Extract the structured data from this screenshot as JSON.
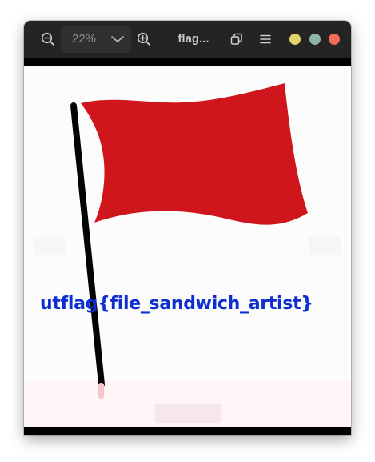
{
  "window": {
    "title": "flag...",
    "zoom_value": "22%"
  },
  "toolbar": {
    "zoom_out_icon": "zoom-out-icon",
    "zoom_in_icon": "zoom-in-icon",
    "zoom_dropdown_icon": "chevron-down-icon",
    "view_icon": "view-icon",
    "menu_icon": "menu-icon"
  },
  "window_controls": {
    "minimize_color": "#e1d46e",
    "maximize_color": "#8ab5a8",
    "close_color": "#f06c58"
  },
  "image": {
    "caption": "utflag{file_sandwich_artist}",
    "flag_color": "#d0161d",
    "pole_color": "#050505",
    "text_color": "#0d2fd0"
  }
}
